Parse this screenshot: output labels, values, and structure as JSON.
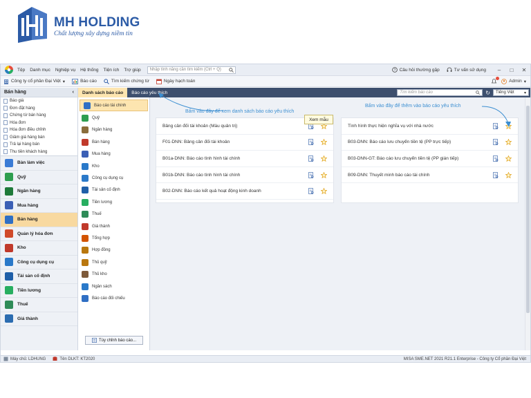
{
  "logo": {
    "title": "MH HOLDING",
    "subtitle": "Chất lượng xây dựng niềm tin",
    "accent": "#2c5ba6"
  },
  "menubar": {
    "items": [
      "Tệp",
      "Danh mục",
      "Nghiệp vụ",
      "Hệ thống",
      "Tiện ích",
      "Trợ giúp"
    ],
    "search_placeholder": "Nhập tính năng cần tìm kiếm (Ctrl + Q)",
    "faq": "Câu hỏi thường gặp",
    "consult": "Tư vấn sử dụng"
  },
  "toolbar": {
    "company": "Công ty cổ phần Đại Việt",
    "report": "Báo cáo",
    "search_doc": "Tìm kiếm chứng từ",
    "posting_date": "Ngày hạch toán",
    "user": "Admin"
  },
  "sidebar": {
    "title": "Bán hàng",
    "sub_items": [
      "Báo giá",
      "Đơn đặt hàng",
      "Chứng từ bán hàng",
      "Hóa đơn",
      "Hóa đơn điều chỉnh",
      "Giảm giá hàng bán",
      "Trả lại hàng bán",
      "Thu tiền khách hàng"
    ],
    "modules": [
      {
        "label": "Bàn làm việc",
        "color": "#3a7bd5"
      },
      {
        "label": "Quỹ",
        "color": "#2e9e4f"
      },
      {
        "label": "Ngân hàng",
        "color": "#1f7a3a"
      },
      {
        "label": "Mua hàng",
        "color": "#3b5fb5"
      },
      {
        "label": "Bán hàng",
        "color": "#2f6fc4"
      },
      {
        "label": "Quản lý hóa đơn",
        "color": "#d04a2a"
      },
      {
        "label": "Kho",
        "color": "#c0392b"
      },
      {
        "label": "Công cụ dụng cụ",
        "color": "#2a79c9"
      },
      {
        "label": "Tài sản cố định",
        "color": "#1f5fa8"
      },
      {
        "label": "Tiền lương",
        "color": "#27ae60"
      },
      {
        "label": "Thuế",
        "color": "#2e8b57"
      },
      {
        "label": "Giá thành",
        "color": "#2b6cb0"
      }
    ],
    "active_module": "Bán hàng"
  },
  "tabs": {
    "items": [
      "Danh sách báo cáo",
      "Báo cáo yêu thích"
    ],
    "search_placeholder": "Tìm kiếm báo cáo",
    "language": "Tiếng Việt"
  },
  "categories": {
    "items": [
      {
        "label": "Báo cáo tài chính",
        "color": "#2f6fc4"
      },
      {
        "label": "Quỹ",
        "color": "#2e9e4f"
      },
      {
        "label": "Ngân hàng",
        "color": "#8a6d3b"
      },
      {
        "label": "Bán hàng",
        "color": "#c0392b"
      },
      {
        "label": "Mua hàng",
        "color": "#3b5fb5"
      },
      {
        "label": "Kho",
        "color": "#2a79c9"
      },
      {
        "label": "Công cụ dụng cụ",
        "color": "#2a79c9"
      },
      {
        "label": "Tài sản cố định",
        "color": "#1f5fa8"
      },
      {
        "label": "Tiền lương",
        "color": "#27ae60"
      },
      {
        "label": "Thuế",
        "color": "#2e8b57"
      },
      {
        "label": "Giá thành",
        "color": "#c0392b"
      },
      {
        "label": "Tổng hợp",
        "color": "#d35400"
      },
      {
        "label": "Hợp đồng",
        "color": "#b9770e"
      },
      {
        "label": "Thủ quỹ",
        "color": "#b9770e"
      },
      {
        "label": "Thủ kho",
        "color": "#7d5a3a"
      },
      {
        "label": "Ngân sách",
        "color": "#2a79c9"
      },
      {
        "label": "Báo cáo đối chiếu",
        "color": "#2f6fc4"
      }
    ],
    "custom_button": "Tùy chỉnh báo cáo..."
  },
  "reports": {
    "left": [
      "Bảng cân đối tài khoản (Mẫu quản trị)",
      "F01-DNN: Bảng cân đối tài khoản",
      "B01a-DNN: Báo cáo tình hình tài chính",
      "B01b-DNN: Báo cáo tình hình tài chính",
      "B02-DNN: Báo cáo kết quả hoạt động kinh doanh"
    ],
    "right": [
      "Tình hình thực hiện nghĩa vụ với nhà nước",
      "B03-DNN: Báo cáo lưu chuyển tiền tệ (PP trực tiếp)",
      "B03-DNN-GT: Báo cáo lưu chuyển tiền tệ (PP gián tiếp)",
      "B09-DNN: Thuyết minh báo cáo tài chính"
    ]
  },
  "tooltip": "Xem mẫu",
  "annotations": {
    "left": "Bấm vào đây để xem danh sách báo cáo yêu thích",
    "right": "Bấm vào đây để thêm vào báo cáo yêu thích"
  },
  "status": {
    "server": "Máy chủ: LDHUNG",
    "database": "Tên DLKT: KT2020",
    "version": "MISA SME.NET 2021 R21.1 Enterprise - Công ty Cổ phần Đại Việt"
  }
}
